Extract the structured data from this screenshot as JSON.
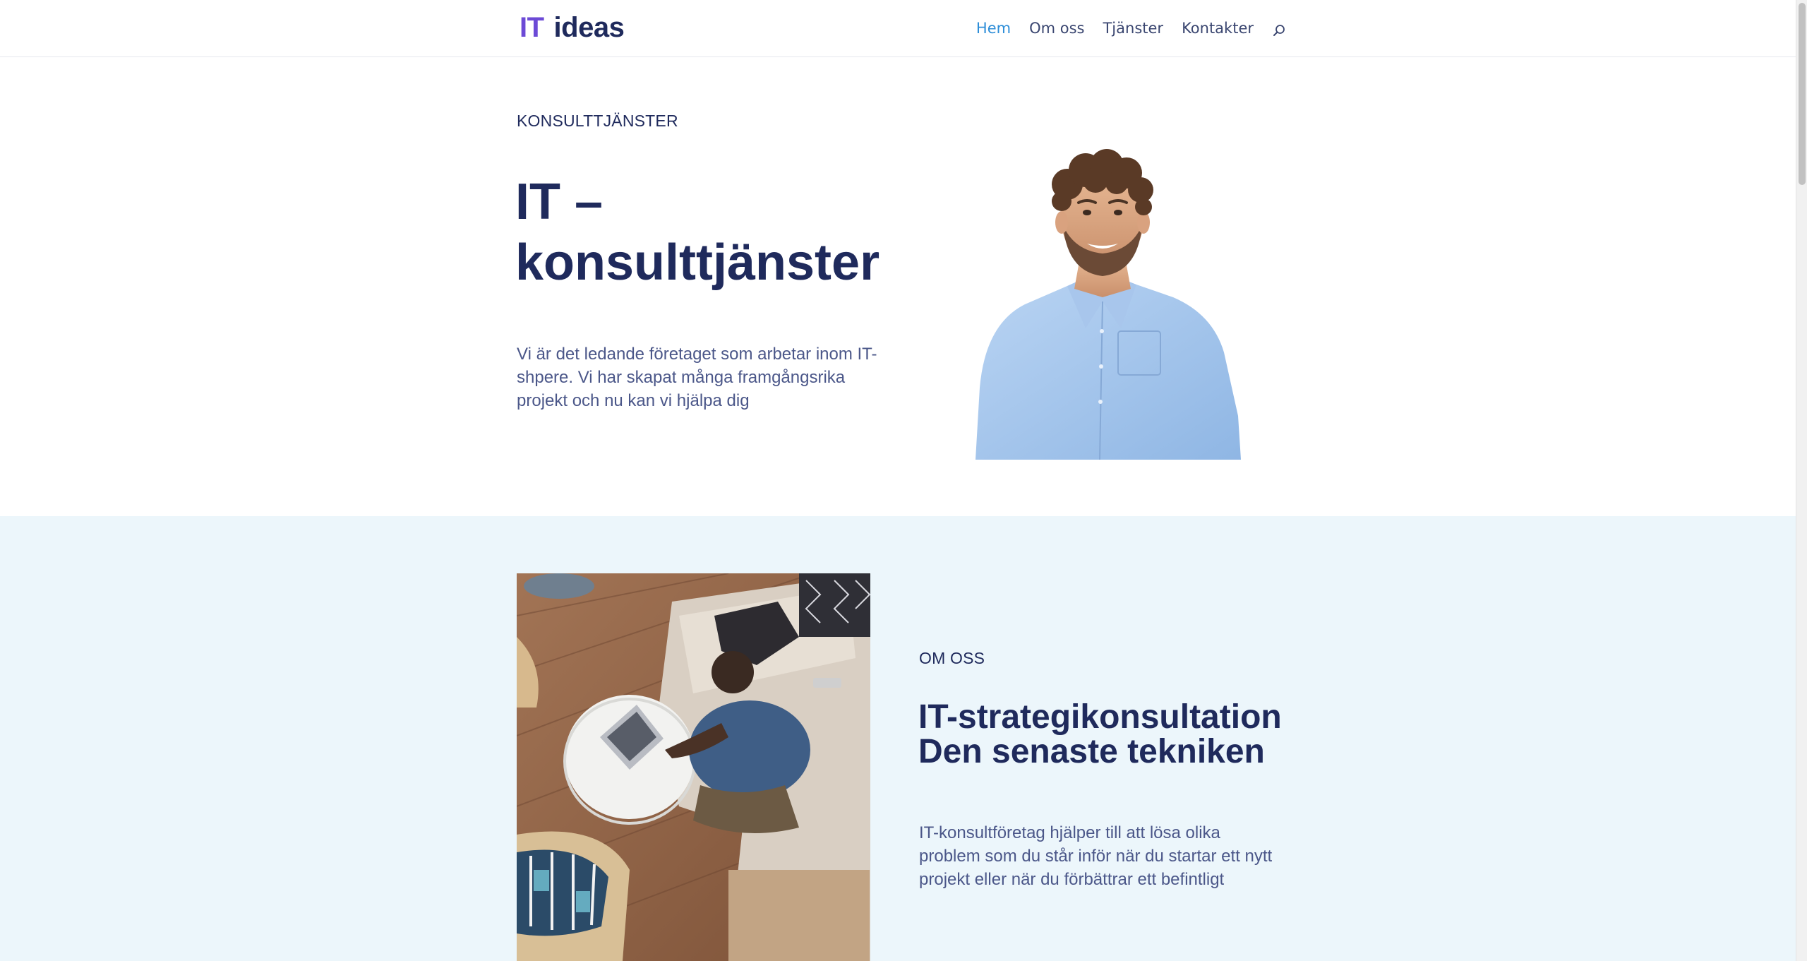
{
  "header": {
    "logo": {
      "part1": "IT",
      "part2": "ideas"
    },
    "nav": [
      {
        "label": "Hem",
        "active": true
      },
      {
        "label": "Om oss",
        "active": false
      },
      {
        "label": "Tjänster",
        "active": false
      },
      {
        "label": "Kontakter",
        "active": false
      }
    ],
    "search_icon": "search-icon"
  },
  "hero": {
    "eyebrow": "KONSULTTJÄNSTER",
    "title": "IT – konsulttjänster",
    "text": "Vi är det ledande företaget som arbetar inom IT-shpere. Vi har skapat många framgångsrika projekt och nu kan vi hjälpa dig"
  },
  "about": {
    "eyebrow": "OM OSS",
    "title_line1": "IT-strategikonsultation",
    "title_line2": "Den senaste tekniken",
    "text": "IT-konsultföretag hjälper till att lösa olika problem som du står inför när du startar ett nytt projekt eller när du förbättrar ett befintligt"
  },
  "colors": {
    "primary_dark": "#1f2a5c",
    "logo_accent": "#6c4ad6",
    "nav_active": "#2e8ed8",
    "body_text": "#4b5789",
    "about_background": "#ecf6fb"
  }
}
